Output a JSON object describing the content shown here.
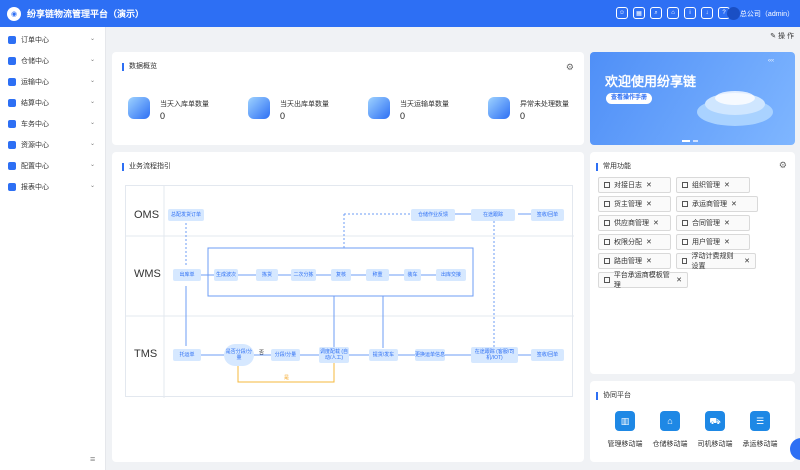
{
  "header": {
    "title": "纷享链物流管理平台（演示）",
    "user": "总公司（admin）"
  },
  "sidebar": {
    "items": [
      {
        "label": "订单中心"
      },
      {
        "label": "仓储中心"
      },
      {
        "label": "运输中心"
      },
      {
        "label": "结算中心"
      },
      {
        "label": "车务中心"
      },
      {
        "label": "资源中心"
      },
      {
        "label": "配置中心"
      },
      {
        "label": "报表中心"
      }
    ]
  },
  "toolbar": {
    "operate": "操 作"
  },
  "overview": {
    "title": "数据概览",
    "stats": [
      {
        "label": "当天入库单数量",
        "value": "0"
      },
      {
        "label": "当天出库单数量",
        "value": "0"
      },
      {
        "label": "当天运输单数量",
        "value": "0"
      },
      {
        "label": "异常未处理数量",
        "value": "0"
      }
    ]
  },
  "banner": {
    "title": "欢迎使用纷享链",
    "button": "查看操作手册"
  },
  "flow": {
    "title": "业务流程指引",
    "rows": [
      "OMS",
      "WMS",
      "TMS"
    ],
    "oms_nodes": [
      "总配发货订单",
      "仓储作业反馈",
      "在途跟踪",
      "签收/回单"
    ],
    "wms_nodes": [
      "出库单",
      "生成波次",
      "拣货",
      "二次分拣",
      "复核",
      "称重",
      "装车",
      "出库交接"
    ],
    "tms_nodes": [
      "托运单",
      "是否分段/分量",
      "分段/分量",
      "调度配载\n(自动/人工)",
      "提货/发车",
      "更换运单信息",
      "在途跟踪\n(客服/司机/IOT)",
      "签收/回单"
    ],
    "yes": "是",
    "no": "否"
  },
  "common": {
    "title": "常用功能",
    "tags": [
      "对接日志",
      "组织管理",
      "货主管理",
      "承运商管理",
      "供应商管理",
      "合同管理",
      "权限分配",
      "用户管理",
      "路由管理",
      "浮动计费规则设置",
      "平台承运商模板管理"
    ]
  },
  "collab": {
    "title": "协同平台",
    "items": [
      "管理移动端",
      "仓储移动端",
      "司机移动端",
      "承运移动端"
    ]
  },
  "colors": {
    "primary": "#2d6ff4"
  }
}
